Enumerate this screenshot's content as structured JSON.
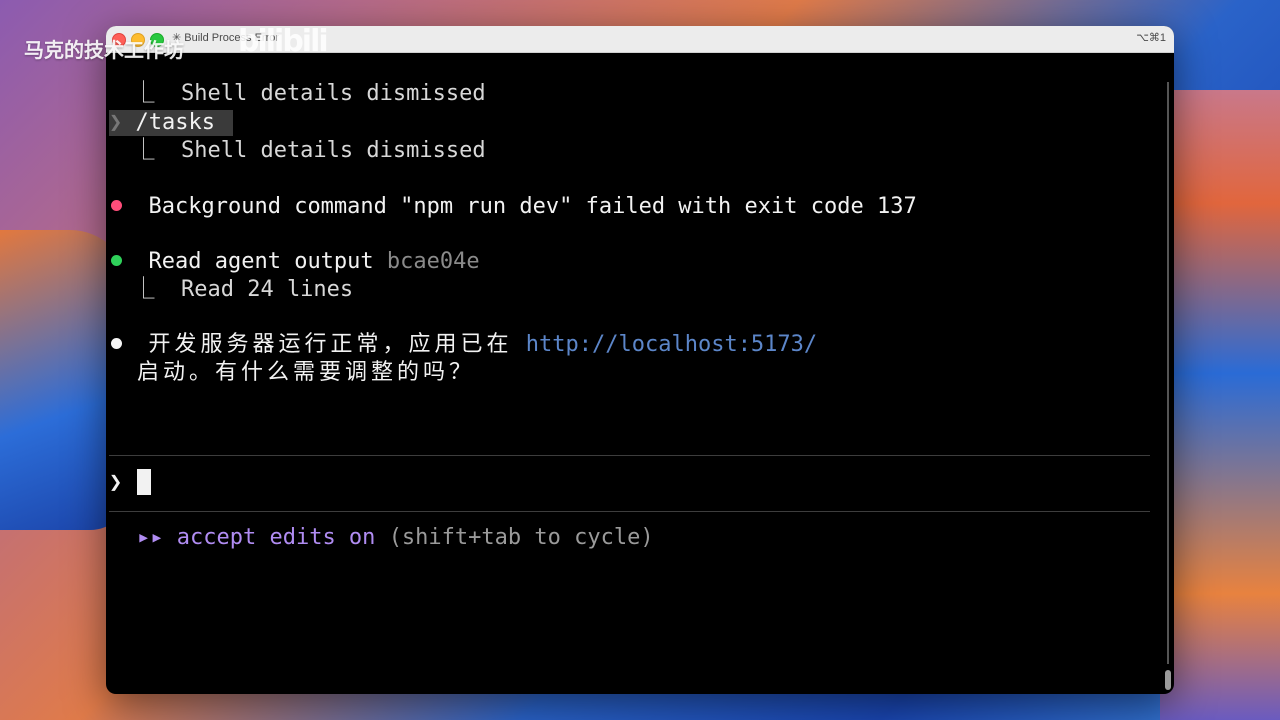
{
  "overlay": {
    "watermark_text": "马克的技术工作坊",
    "logo_text": "bilibili"
  },
  "window": {
    "title": "✳ Build Process Error",
    "shortcut": "⌥⌘1"
  },
  "terminal": {
    "line_0": "  ⎿  Shell details dismissed",
    "command_chevron": "❯",
    "command_text": "/tasks",
    "line_1": "  ⎿  Shell details dismissed",
    "error_text": "Background command \"npm run dev\" failed with exit code 137",
    "read_label": "Read agent output",
    "read_hash": "bcae04e",
    "read_result": "  ⎿  Read 24 lines",
    "reply_part1": "开发服务器运行正常，应用已在",
    "reply_link": "http://localhost:5173/",
    "reply_part2": "启动。有什么需要调整的吗？",
    "prompt_chevron": "❯",
    "mode_arrows": "▸▸",
    "mode_label": "accept edits on",
    "mode_hint": "(shift+tab to cycle)"
  },
  "colors": {
    "error_dot": "#ff4d7a",
    "success_dot": "#2fd15a",
    "link": "#5c86c9",
    "mode_accent": "#b08cf2"
  }
}
